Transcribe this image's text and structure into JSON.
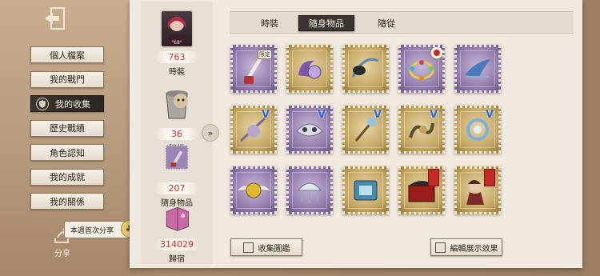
{
  "nav": {
    "items": [
      {
        "label": "個人檔案"
      },
      {
        "label": "我的戰門"
      },
      {
        "label": "我的收集"
      },
      {
        "label": "歷史戰績"
      },
      {
        "label": "角色認知"
      },
      {
        "label": "我的成就"
      },
      {
        "label": "我的關係"
      }
    ],
    "active_index": 2
  },
  "share": {
    "badge": "本週首次分享",
    "label": "分享"
  },
  "categories": [
    {
      "count": "763",
      "label": "時裝",
      "card_text": "\"68\""
    },
    {
      "count": "36",
      "label": "隨從"
    },
    {
      "count": "207",
      "label": "隨身物品"
    },
    {
      "count": "314029",
      "label": "歸宿"
    }
  ],
  "tabs": [
    {
      "label": "時裝"
    },
    {
      "label": "隨身物品"
    },
    {
      "label": "隨從"
    }
  ],
  "active_tab": 1,
  "stamp_badges": {
    "limit": "限定",
    "v": "V"
  },
  "buttons": {
    "gallery": "收集圖鑑",
    "edit_display": "編輯展示效果"
  },
  "colors": {
    "accent_red": "#b8322b",
    "tab_active": "#3a3632",
    "stamp_purple": "#8f77a9",
    "stamp_gold": "#c2a461"
  }
}
